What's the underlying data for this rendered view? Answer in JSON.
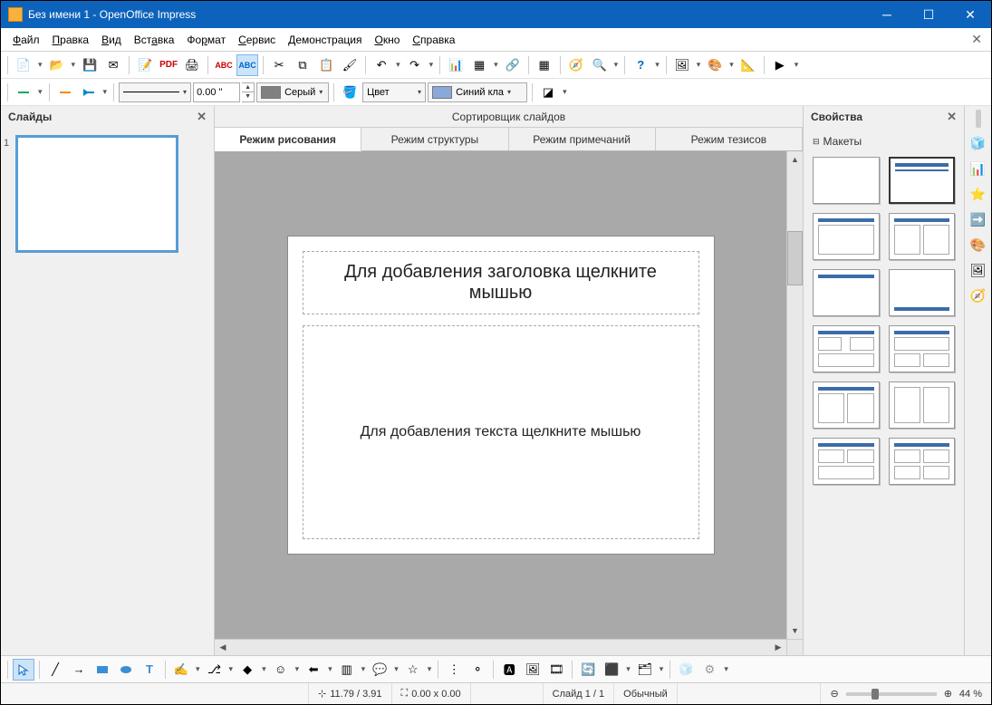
{
  "window": {
    "title": "Без имени 1 - OpenOffice Impress"
  },
  "menubar": [
    "Файл",
    "Правка",
    "Вид",
    "Вставка",
    "Формат",
    "Сервис",
    "Демонстрация",
    "Окно",
    "Справка"
  ],
  "toolbar2": {
    "line_width": "0.00 \"",
    "line_color_label": "Серый",
    "line_color_hex": "#808080",
    "fill_mode": "Цвет",
    "fill_color_label": "Синий кла",
    "fill_color_hex": "#8aa8d8"
  },
  "slides_panel": {
    "title": "Слайды",
    "items": [
      {
        "num": "1"
      }
    ]
  },
  "center": {
    "header": "Сортировщик слайдов",
    "tabs": [
      "Режим рисования",
      "Режим структуры",
      "Режим примечаний",
      "Режим тезисов"
    ],
    "active_tab": 0,
    "slide": {
      "title_placeholder": "Для добавления заголовка щелкните мышью",
      "body_placeholder": "Для добавления текста щелкните мышью"
    }
  },
  "props": {
    "title": "Свойства",
    "section": "Макеты"
  },
  "status": {
    "pos": "11.79 / 3.91",
    "size": "0.00 x 0.00",
    "slide": "Слайд 1 / 1",
    "mode": "Обычный",
    "zoom": "44 %"
  }
}
